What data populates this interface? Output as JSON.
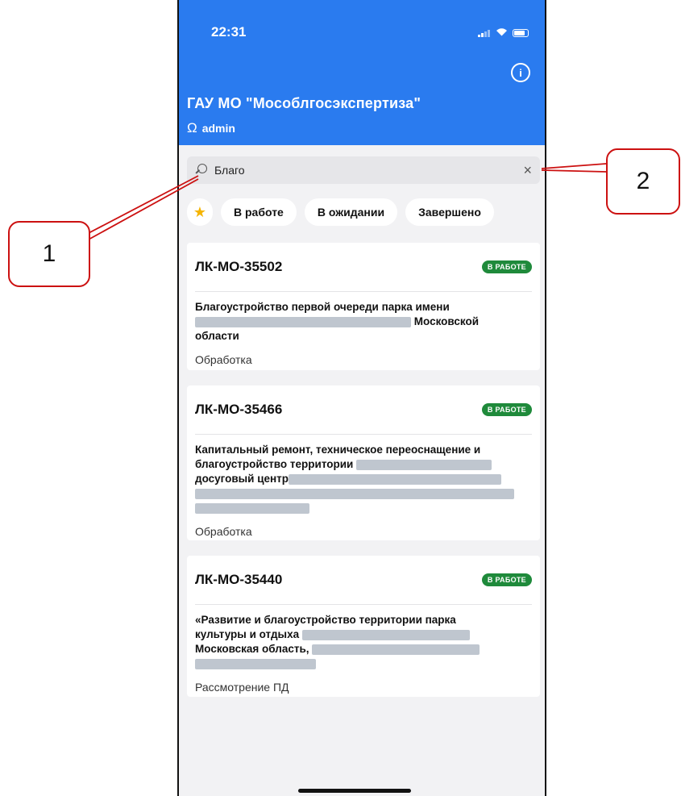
{
  "status_bar": {
    "time": "22:31"
  },
  "header": {
    "org_title": "ГАУ МО \"Мособлгосэкспертиза\"",
    "user_name": "admin",
    "info_icon": "info-icon"
  },
  "search": {
    "value": "Благо",
    "clear_label": "×"
  },
  "filters": {
    "star": "★",
    "chips": [
      "В работе",
      "В ожидании",
      "Завершено"
    ]
  },
  "cards": [
    {
      "id": "ЛК-МО-35502",
      "badge": "В РАБОТЕ",
      "desc_1": "Благоустройство первой очереди парка имени",
      "desc_2": "Московской",
      "desc_3": "области",
      "status": "Обработка"
    },
    {
      "id": "ЛК-МО-35466",
      "badge": "В РАБОТЕ",
      "desc_1": "Капитальный ремонт, техническое переоснащение и",
      "desc_2": "благоустройство территории",
      "desc_3": "досуговый центр",
      "status": "Обработка"
    },
    {
      "id": "ЛК-МО-35440",
      "badge": "В РАБОТЕ",
      "desc_1": "«Развитие и благоустройство территории парка",
      "desc_2": "культуры и отдыха",
      "desc_3": "Московская область,",
      "status": "Рассмотрение ПД"
    }
  ],
  "callouts": [
    "1",
    "2"
  ],
  "colors": {
    "header": "#2a7bef",
    "badge": "#1f8a3b",
    "callout_border": "#cc1111",
    "star": "#f5b400"
  }
}
